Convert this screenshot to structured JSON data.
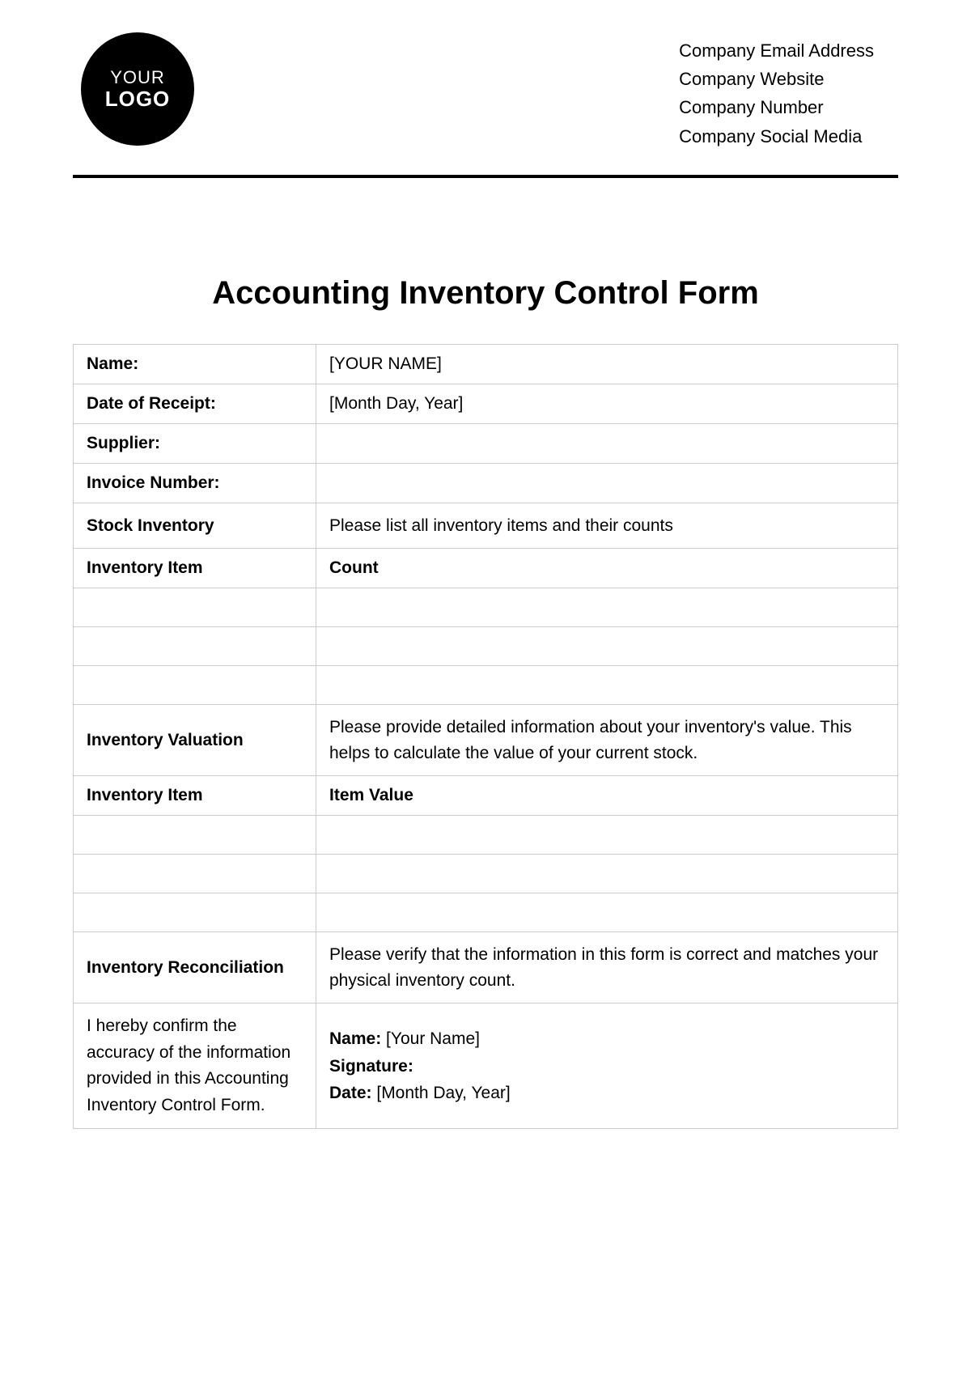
{
  "header": {
    "logo_line1": "YOUR",
    "logo_line2": "LOGO",
    "company_lines": [
      "Company Email Address",
      "Company Website",
      "Company Number",
      "Company Social Media"
    ]
  },
  "title": "Accounting Inventory Control Form",
  "fields": {
    "name_label": "Name:",
    "name_value": "[YOUR NAME]",
    "date_label": "Date of Receipt:",
    "date_value": "[Month Day, Year]",
    "supplier_label": "Supplier:",
    "supplier_value": "",
    "invoice_label": "Invoice Number:",
    "invoice_value": ""
  },
  "stock": {
    "heading": "Stock Inventory",
    "instruction": "Please list all inventory items and their counts",
    "col1": "Inventory Item",
    "col2": "Count"
  },
  "valuation": {
    "heading": "Inventory Valuation",
    "instruction": "Please provide detailed information about your inventory's value. This helps to calculate the value of your current stock.",
    "col1": "Inventory Item",
    "col2": "Item Value"
  },
  "reconciliation": {
    "heading": "Inventory Reconciliation",
    "instruction": "Please verify that the information in this form is correct and matches your physical inventory count.",
    "confirm_text": "I hereby confirm the accuracy of the information provided in this Accounting Inventory Control Form.",
    "sig_name_label": "Name:",
    "sig_name_value": "[Your Name]",
    "sig_signature_label": "Signature:",
    "sig_signature_value": "",
    "sig_date_label": "Date:",
    "sig_date_value": "[Month Day, Year]"
  }
}
